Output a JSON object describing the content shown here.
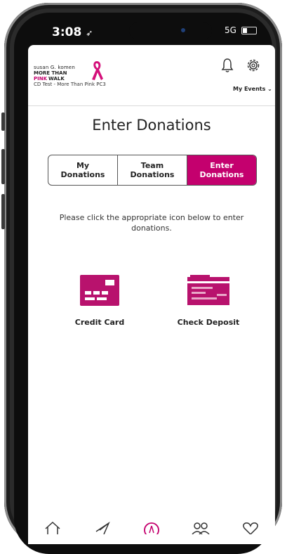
{
  "status_bar": {
    "time": "3:08",
    "signal": "5G"
  },
  "header": {
    "logo_line1": "susan G. komen",
    "logo_line2": "MORE THAN",
    "logo_line3_pink": "PINK",
    "logo_line3_dark": "WALK",
    "event_name": "CD Test - More Than Pink PC3",
    "my_events_label": "My Events"
  },
  "page": {
    "title": "Enter Donations"
  },
  "tabs": [
    {
      "label": "My\nDonations",
      "active": false
    },
    {
      "label": "Team\nDonations",
      "active": false
    },
    {
      "label": "Enter\nDonations",
      "active": true
    }
  ],
  "instructions": "Please click the appropriate icon below to enter donations.",
  "options": {
    "credit_card_label": "Credit Card",
    "check_deposit_label": "Check Deposit"
  },
  "colors": {
    "accent": "#c4006e"
  },
  "nav_icons": [
    "home-icon",
    "send-icon",
    "ribbon-icon",
    "people-icon",
    "heart-icon"
  ]
}
